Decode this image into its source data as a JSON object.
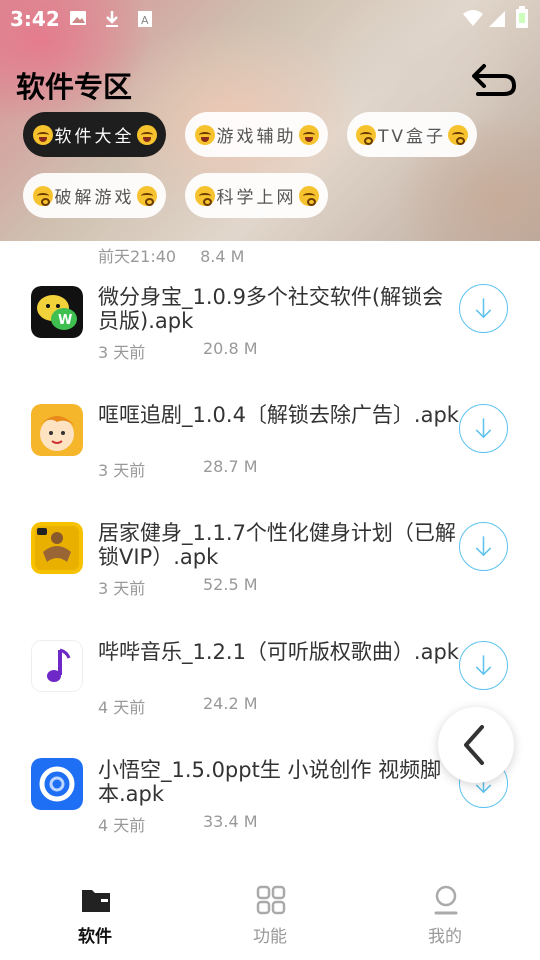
{
  "status_bar": {
    "time": "3:42"
  },
  "header": {
    "title": "软件专区"
  },
  "chips": [
    {
      "label": "软件大全",
      "emoji": "smiling-face-icon",
      "active": true
    },
    {
      "label": "游戏辅助",
      "emoji": "smiling-face-icon",
      "active": false
    },
    {
      "label": "TV盒子",
      "emoji": "kissing-face-icon",
      "active": false
    },
    {
      "label": "破解游戏",
      "emoji": "kissing-face-icon",
      "active": false
    },
    {
      "label": "科学上网",
      "emoji": "kissing-face-icon",
      "active": false
    }
  ],
  "previous_item": {
    "time": "前天21:40",
    "size": "8.4 M"
  },
  "apps": [
    {
      "name": "微分身宝_1.0.9多个社交软件(解锁会员版).apk",
      "time": "3 天前",
      "size": "20.8 M",
      "icon": "wechat-clone-icon"
    },
    {
      "name": "哐哐追剧_1.0.4〔解锁去除广告〕.apk",
      "time": "3 天前",
      "size": "28.7 M",
      "icon": "cartoon-face-icon"
    },
    {
      "name": "居家健身_1.1.7个性化健身计划（已解锁VIP）.apk",
      "time": "3 天前",
      "size": "52.5 M",
      "icon": "fitness-icon"
    },
    {
      "name": "哔哔音乐_1.2.1（可听版权歌曲）.apk",
      "time": "4 天前",
      "size": "24.2 M",
      "icon": "music-note-icon"
    },
    {
      "name": "小悟空_1.5.0ppt生 小说创作 视频脚本.apk",
      "time": "4 天前",
      "size": "33.4 M",
      "icon": "swirl-icon"
    }
  ],
  "tabs": [
    {
      "label": "软件",
      "icon": "folder-icon",
      "active": true
    },
    {
      "label": "功能",
      "icon": "grid-icon",
      "active": false
    },
    {
      "label": "我的",
      "icon": "person-icon",
      "active": false
    }
  ],
  "colors": {
    "accent": "#5ec3ee",
    "active_chip": "#1e1e1e",
    "muted_text": "#999999"
  }
}
